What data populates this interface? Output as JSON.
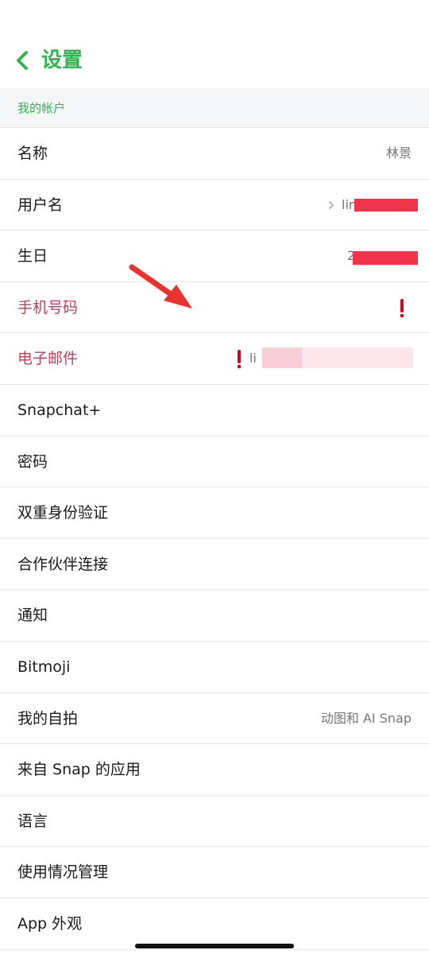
{
  "header": {
    "title": "设置",
    "back_icon": "chevron-left-icon"
  },
  "section": {
    "title": "我的帐户"
  },
  "rows": [
    {
      "label": "名称",
      "value": "林景",
      "warn": false
    },
    {
      "label": "用户名",
      "value": "linj",
      "warn": false
    },
    {
      "label": "生日",
      "value": "2",
      "warn": false
    },
    {
      "label": "手机号码",
      "value": "",
      "warn": true
    },
    {
      "label": "电子邮件",
      "value": "li",
      "warn": true
    },
    {
      "label": "Snapchat+",
      "value": "",
      "warn": false
    },
    {
      "label": "密码",
      "value": "",
      "warn": false
    },
    {
      "label": "双重身份验证",
      "value": "",
      "warn": false
    },
    {
      "label": "合作伙伴连接",
      "value": "",
      "warn": false
    },
    {
      "label": "通知",
      "value": "",
      "warn": false
    },
    {
      "label": "Bitmoji",
      "value": "",
      "warn": false
    },
    {
      "label": "我的自拍",
      "value": "动图和 AI Snap",
      "warn": false
    },
    {
      "label": "来自 Snap 的应用",
      "value": "",
      "warn": false
    },
    {
      "label": "语言",
      "value": "",
      "warn": false
    },
    {
      "label": "使用情况管理",
      "value": "",
      "warn": false
    },
    {
      "label": "App 外观",
      "value": "",
      "warn": false
    }
  ],
  "colors": {
    "accent": "#2fb44e",
    "warning": "#c33d58",
    "alert": "#d0021b",
    "redaction": "#f0344a"
  }
}
